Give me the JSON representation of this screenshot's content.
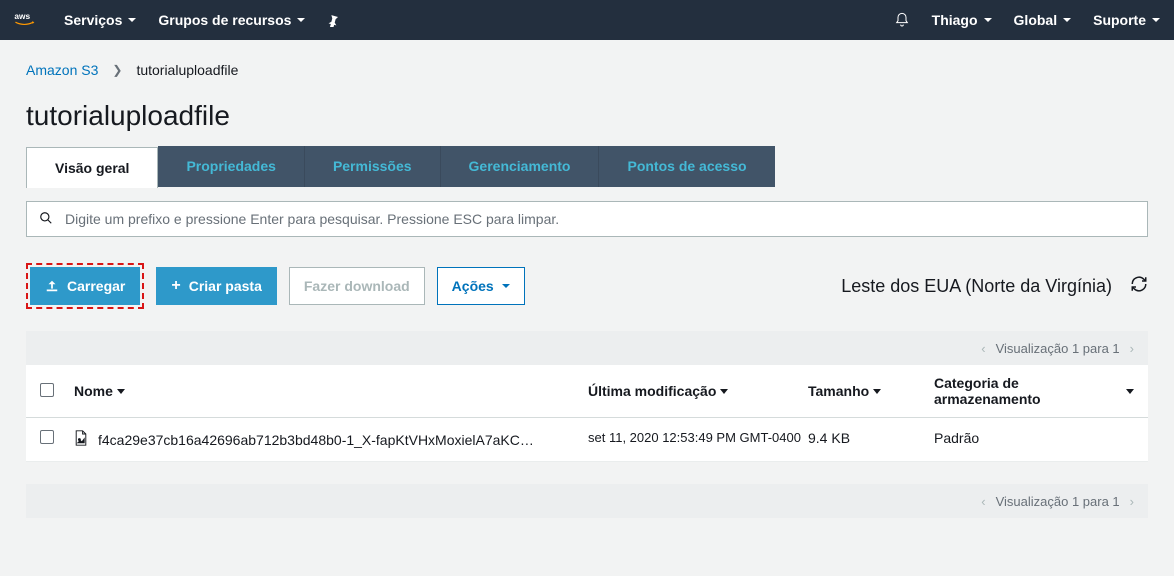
{
  "nav": {
    "services": "Serviços",
    "resource_groups": "Grupos de recursos",
    "user": "Thiago",
    "region": "Global",
    "support": "Suporte"
  },
  "breadcrumb": {
    "root": "Amazon S3",
    "current": "tutorialuploadfile"
  },
  "page_title": "tutorialuploadfile",
  "tabs": {
    "overview": "Visão geral",
    "properties": "Propriedades",
    "permissions": "Permissões",
    "management": "Gerenciamento",
    "access_points": "Pontos de acesso"
  },
  "search": {
    "placeholder": "Digite um prefixo e pressione Enter para pesquisar. Pressione ESC para limpar."
  },
  "toolbar": {
    "upload": "Carregar",
    "create_folder": "Criar pasta",
    "download": "Fazer download",
    "actions": "Ações",
    "region_display": "Leste dos EUA (Norte da Virgínia)"
  },
  "pagination": {
    "label": "Visualização 1 para 1"
  },
  "table": {
    "headers": {
      "name": "Nome",
      "modified": "Última modificação",
      "size": "Tamanho",
      "storage": "Categoria de armazenamento"
    },
    "rows": [
      {
        "name": "f4ca29e37cb16a42696ab712b3bd48b0-1_X-fapKtVHxMoxielA7aKC…",
        "modified": "set 11, 2020 12:53:49 PM GMT-0400",
        "size": "9.4 KB",
        "storage": "Padrão"
      }
    ]
  }
}
